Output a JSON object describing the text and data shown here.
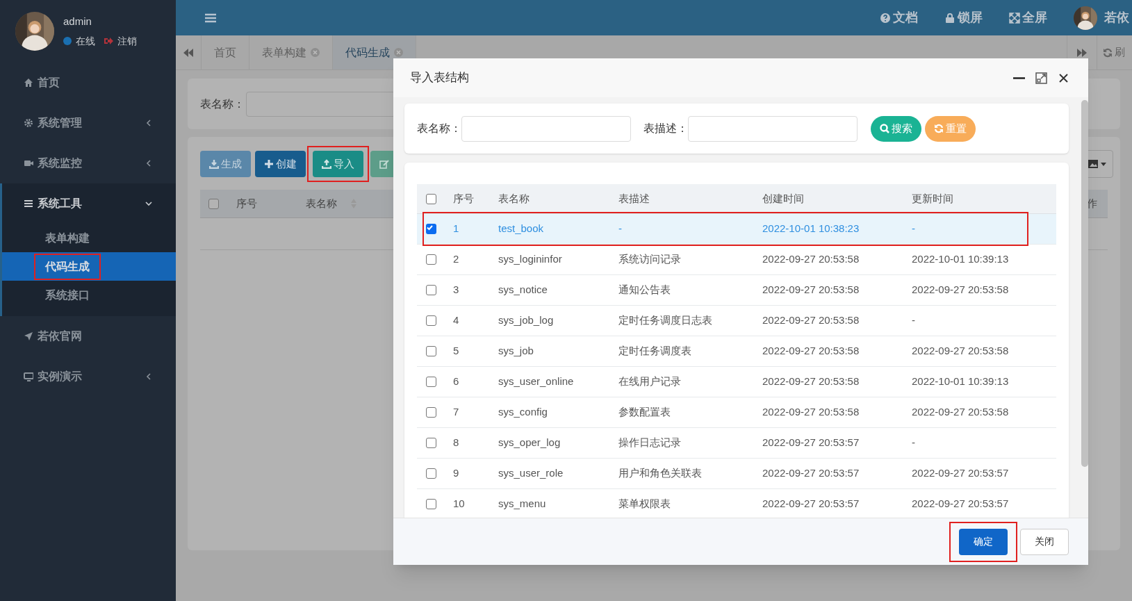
{
  "sidebar": {
    "user": {
      "name": "admin",
      "status": "在线",
      "logout": "注销"
    },
    "items": [
      {
        "label": "首页",
        "kind": "link",
        "expanded": false
      },
      {
        "label": "系统管理",
        "kind": "menu",
        "expanded": false
      },
      {
        "label": "系统监控",
        "kind": "menu",
        "expanded": false
      },
      {
        "label": "系统工具",
        "kind": "menu",
        "expanded": true,
        "children": [
          {
            "label": "表单构建",
            "selected": false,
            "highlighted": false
          },
          {
            "label": "代码生成",
            "selected": true,
            "highlighted": true
          },
          {
            "label": "系统接口",
            "selected": false,
            "highlighted": false
          }
        ]
      },
      {
        "label": "若依官网",
        "kind": "link",
        "expanded": false
      },
      {
        "label": "实例演示",
        "kind": "menu",
        "expanded": false
      }
    ]
  },
  "topbar": {
    "links": [
      "文档",
      "锁屏",
      "全屏"
    ],
    "user": "若依"
  },
  "tabs": {
    "items": [
      {
        "label": "首页",
        "closable": false,
        "selected": false
      },
      {
        "label": "表单构建",
        "closable": true,
        "selected": false
      },
      {
        "label": "代码生成",
        "closable": true,
        "selected": true
      }
    ],
    "refresh": "刷"
  },
  "page": {
    "search_label": "表名称：",
    "toolbar": [
      {
        "label": "生成",
        "kind": "generate",
        "highlighted": false
      },
      {
        "label": "创建",
        "kind": "create",
        "highlighted": false
      },
      {
        "label": "导入",
        "kind": "import",
        "highlighted": true
      },
      {
        "kind": "edit",
        "highlighted": false
      }
    ],
    "table": {
      "all_checked": false,
      "columns": [
        "序号",
        "表名称"
      ],
      "column_end": "作"
    }
  },
  "modal": {
    "title": "导入表结构",
    "search": {
      "fields": [
        {
          "label": "表名称："
        },
        {
          "label": "表描述："
        }
      ],
      "buttons": [
        {
          "label": "搜索",
          "kind": "search"
        },
        {
          "label": "重置",
          "kind": "reset"
        }
      ]
    },
    "table": {
      "all_checked": false,
      "columns": [
        "序号",
        "表名称",
        "表描述",
        "创建时间",
        "更新时间"
      ],
      "rows": [
        {
          "checked": true,
          "highlighted": true,
          "cells": [
            "1",
            "test_book",
            "-",
            "2022-10-01 10:38:23",
            "-"
          ]
        },
        {
          "checked": false,
          "highlighted": false,
          "cells": [
            "2",
            "sys_logininfor",
            "系统访问记录",
            "2022-09-27 20:53:58",
            "2022-10-01 10:39:13"
          ]
        },
        {
          "checked": false,
          "highlighted": false,
          "cells": [
            "3",
            "sys_notice",
            "通知公告表",
            "2022-09-27 20:53:58",
            "2022-09-27 20:53:58"
          ]
        },
        {
          "checked": false,
          "highlighted": false,
          "cells": [
            "4",
            "sys_job_log",
            "定时任务调度日志表",
            "2022-09-27 20:53:58",
            "-"
          ]
        },
        {
          "checked": false,
          "highlighted": false,
          "cells": [
            "5",
            "sys_job",
            "定时任务调度表",
            "2022-09-27 20:53:58",
            "2022-09-27 20:53:58"
          ]
        },
        {
          "checked": false,
          "highlighted": false,
          "cells": [
            "6",
            "sys_user_online",
            "在线用户记录",
            "2022-09-27 20:53:58",
            "2022-10-01 10:39:13"
          ]
        },
        {
          "checked": false,
          "highlighted": false,
          "cells": [
            "7",
            "sys_config",
            "参数配置表",
            "2022-09-27 20:53:58",
            "2022-09-27 20:53:58"
          ]
        },
        {
          "checked": false,
          "highlighted": false,
          "cells": [
            "8",
            "sys_oper_log",
            "操作日志记录",
            "2022-09-27 20:53:57",
            "-"
          ]
        },
        {
          "checked": false,
          "highlighted": false,
          "cells": [
            "9",
            "sys_user_role",
            "用户和角色关联表",
            "2022-09-27 20:53:57",
            "2022-09-27 20:53:57"
          ]
        },
        {
          "checked": false,
          "highlighted": false,
          "cells": [
            "10",
            "sys_menu",
            "菜单权限表",
            "2022-09-27 20:53:57",
            "2022-09-27 20:53:57"
          ]
        }
      ]
    },
    "footer": {
      "buttons": [
        {
          "label": "确定",
          "kind": "primary",
          "highlighted": true
        },
        {
          "label": "关闭",
          "kind": "default",
          "highlighted": false
        }
      ]
    }
  }
}
